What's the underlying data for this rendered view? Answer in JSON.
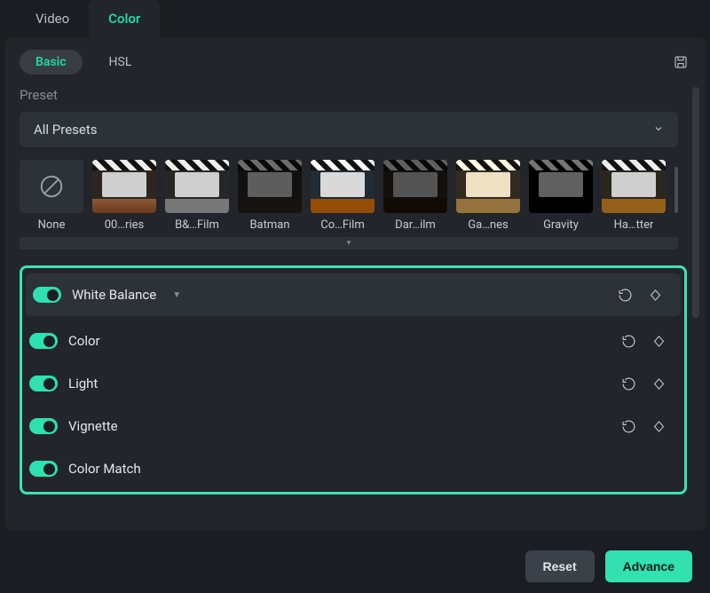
{
  "top_tabs": {
    "video": "Video",
    "color": "Color"
  },
  "sub_tabs": {
    "basic": "Basic",
    "hsl": "HSL"
  },
  "preset_header": "Preset",
  "preset_dropdown": "All Presets",
  "thumbs": [
    {
      "label": "None"
    },
    {
      "label": "00…ries"
    },
    {
      "label": "B&…Film"
    },
    {
      "label": "Batman"
    },
    {
      "label": "Co…Film"
    },
    {
      "label": "Dar…ilm"
    },
    {
      "label": "Ga…nes"
    },
    {
      "label": "Gravity"
    },
    {
      "label": "Ha…tter"
    }
  ],
  "sections": {
    "white_balance": "White Balance",
    "color": "Color",
    "light": "Light",
    "vignette": "Vignette",
    "color_match": "Color Match"
  },
  "buttons": {
    "reset": "Reset",
    "advance": "Advance"
  }
}
